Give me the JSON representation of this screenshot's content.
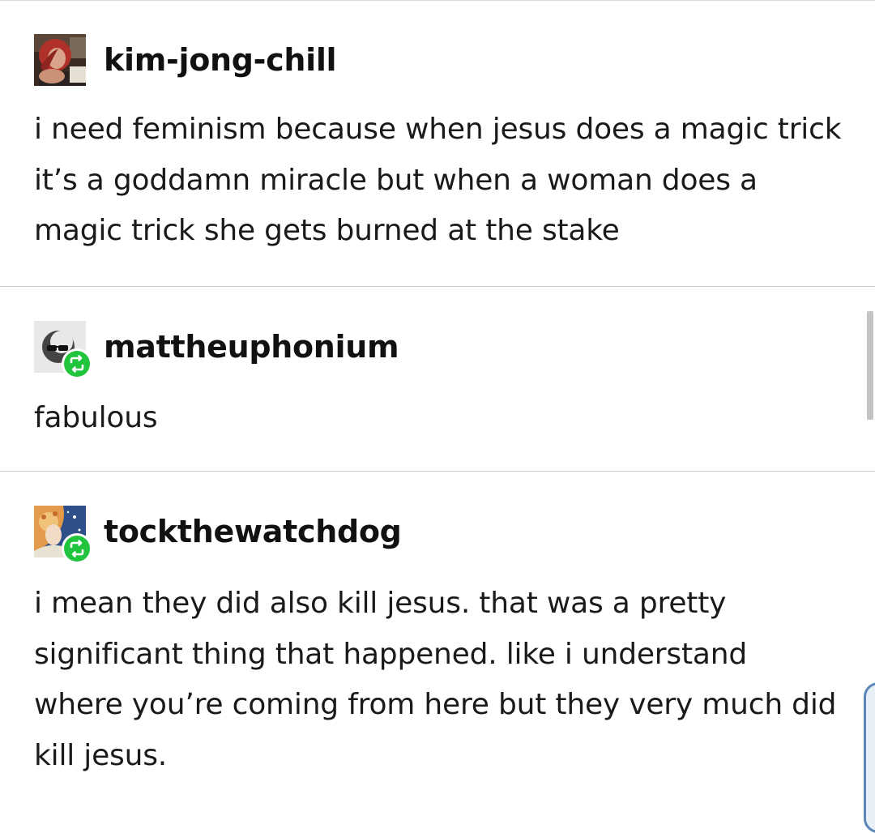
{
  "posts": [
    {
      "username": "kim-jong-chill",
      "avatar_icon": "user-photo-avatar",
      "is_reblog": false,
      "text": "i need feminism because when jesus does a magic trick it’s a goddamn miracle but when a woman does a magic trick she gets burned at the stake"
    },
    {
      "username": "mattheuphonium",
      "avatar_icon": "sunglasses-smiley-avatar",
      "is_reblog": true,
      "reblog_icon": "reblog-icon",
      "text": "fabulous"
    },
    {
      "username": "tockthewatchdog",
      "avatar_icon": "illustrated-portrait-avatar",
      "is_reblog": true,
      "reblog_icon": "reblog-icon",
      "text": "i mean they did also kill jesus. that was a pretty significant thing that happened. like i understand where you’re coming from here but they very much did kill jesus."
    }
  ],
  "colors": {
    "reblog_badge": "#20c43d",
    "divider": "#c8c8c8",
    "text": "#1a1a1a"
  }
}
